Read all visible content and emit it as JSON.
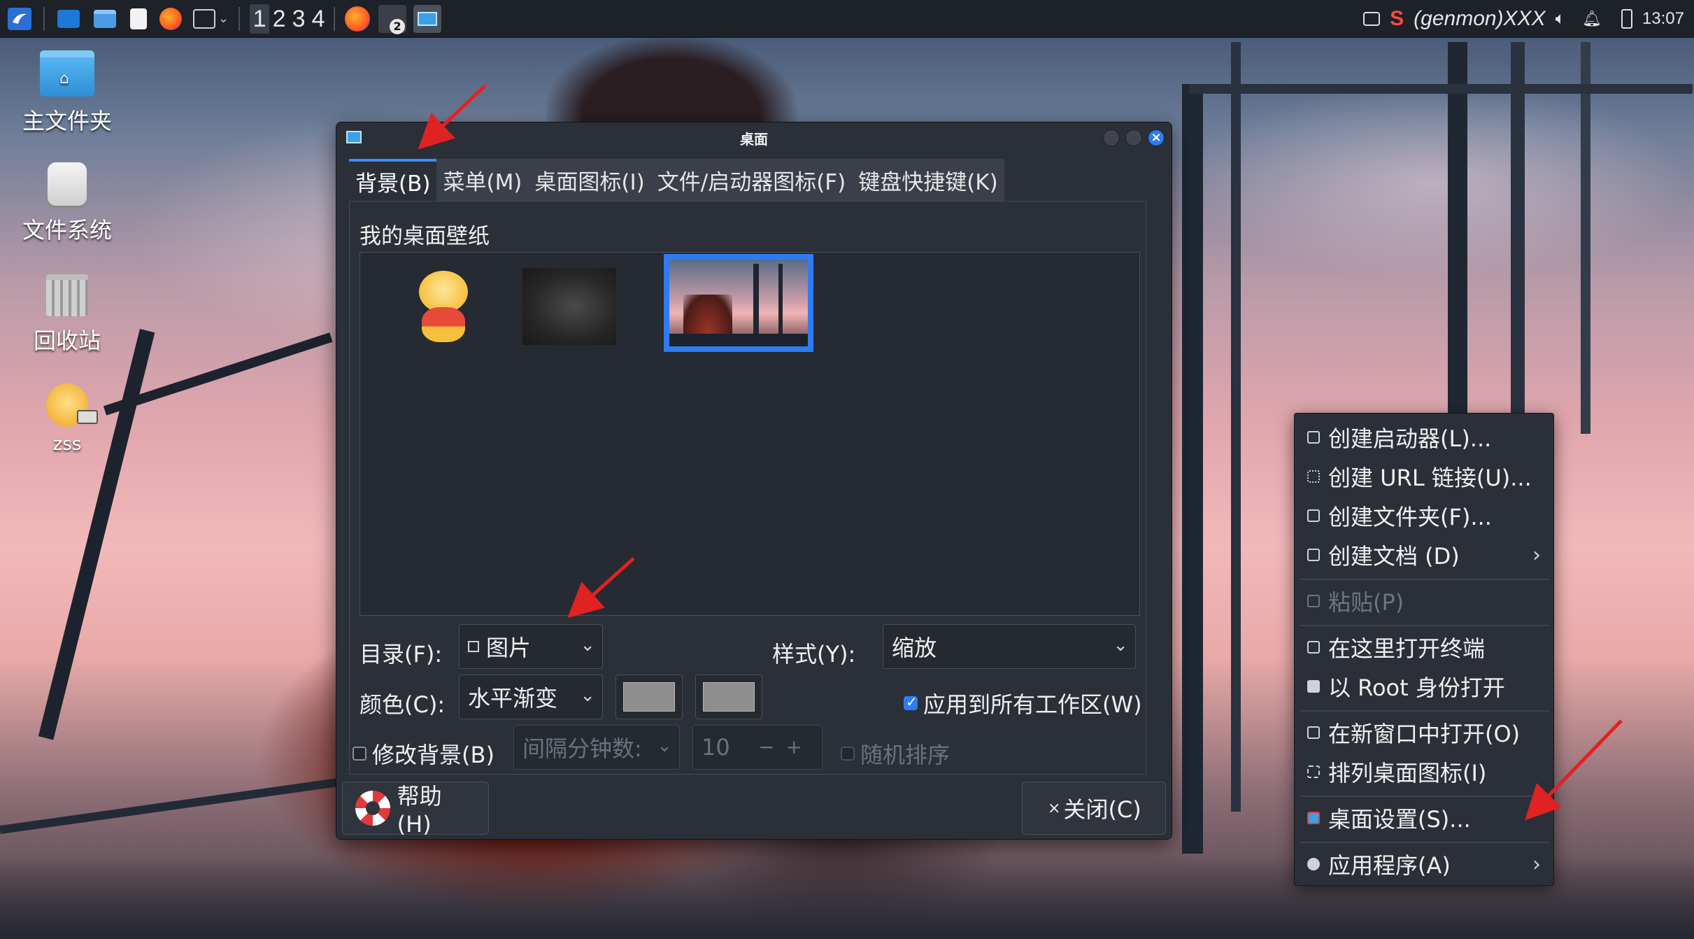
{
  "panel": {
    "workspaces": [
      "1",
      "2",
      "3",
      "4"
    ],
    "active_workspace": "1",
    "badge": "2",
    "genmon": "(genmon)XXX",
    "clock": "13:07"
  },
  "desktop_icons": [
    {
      "label": "主文件夹",
      "icon": "home-folder-icon"
    },
    {
      "label": "文件系统",
      "icon": "filesystem-icon"
    },
    {
      "label": "回收站",
      "icon": "trash-icon"
    },
    {
      "label": "zss",
      "icon": "user-app-icon"
    }
  ],
  "dialog": {
    "title": "桌面",
    "tabs": [
      "背景(B)",
      "菜单(M)",
      "桌面图标(I)",
      "文件/启动器图标(F)",
      "键盘快捷键(K)"
    ],
    "active_tab": "背景(B)",
    "section_label": "我的桌面壁纸",
    "folder_label": "目录(F):",
    "folder_value": "图片",
    "style_label": "样式(Y):",
    "style_value": "缩放",
    "color_label": "颜色(C):",
    "color_value": "水平渐变",
    "color1": "#8e8e8e",
    "color2": "#8e8e8e",
    "apply_all_label": "应用到所有工作区(W)",
    "apply_all_checked": true,
    "change_bg_label": "修改背景(B)",
    "change_bg_checked": false,
    "interval_placeholder": "间隔分钟数:",
    "interval_value": "10",
    "random_label": "随机排序",
    "help_button": "帮助(H)",
    "close_button": "关闭(C)"
  },
  "context_menu": {
    "items": [
      {
        "label": "创建启动器(L)...",
        "enabled": true,
        "submenu": false
      },
      {
        "label": "创建 URL 链接(U)...",
        "enabled": true,
        "submenu": false
      },
      {
        "label": "创建文件夹(F)...",
        "enabled": true,
        "submenu": false
      },
      {
        "label": "创建文档 (D)",
        "enabled": true,
        "submenu": true
      },
      {
        "label": "粘贴(P)",
        "enabled": false,
        "submenu": false
      },
      {
        "label": "在这里打开终端",
        "enabled": true,
        "submenu": false
      },
      {
        "label": "以 Root 身份打开",
        "enabled": true,
        "submenu": false
      },
      {
        "label": "在新窗口中打开(O)",
        "enabled": true,
        "submenu": false
      },
      {
        "label": "排列桌面图标(I)",
        "enabled": true,
        "submenu": false
      },
      {
        "label": "桌面设置(S)...",
        "enabled": true,
        "submenu": false
      },
      {
        "label": "应用程序(A)",
        "enabled": true,
        "submenu": true
      }
    ]
  },
  "colors": {
    "accent": "#2f7bf0",
    "annotation_arrow": "#e02222"
  }
}
